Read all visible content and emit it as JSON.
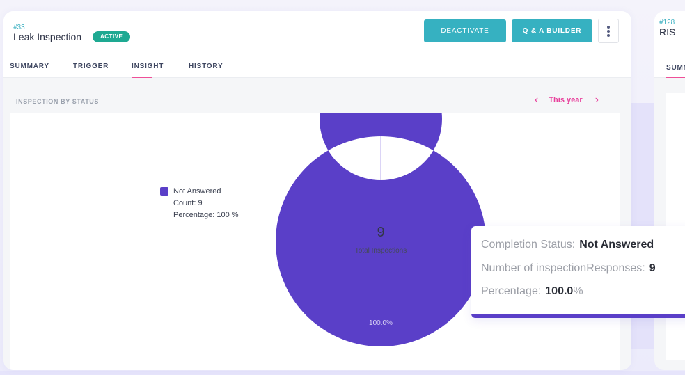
{
  "card": {
    "id": "#33",
    "title": "Leak Inspection",
    "status": "ACTIVE",
    "buttons": {
      "deactivate": "DEACTIVATE",
      "qa_builder": "Q & A BUILDER",
      "more": "more-options"
    },
    "tabs": [
      {
        "label": "SUMMARY",
        "active": false
      },
      {
        "label": "TRIGGER",
        "active": false
      },
      {
        "label": "INSIGHT",
        "active": true
      },
      {
        "label": "HISTORY",
        "active": false
      }
    ],
    "section_title": "INSPECTION BY STATUS",
    "period": {
      "label": "This year",
      "prev": "‹",
      "next": "›"
    }
  },
  "chart": {
    "legend": {
      "label": "Not Answered",
      "count": "Count: 9",
      "percentage": "Percentage: 100 %"
    },
    "center_value": "9",
    "center_label": "Total Inspections",
    "slice_label": "100.0%"
  },
  "chart_data": {
    "type": "pie",
    "variant": "donut",
    "title": "INSPECTION BY STATUS",
    "categories": [
      "Not Answered"
    ],
    "values": [
      9
    ],
    "percentages": [
      100.0
    ],
    "colors": [
      "#5a3fc8"
    ],
    "total": 9,
    "center_text": "Total Inspections",
    "legend_position": "left"
  },
  "tooltip": {
    "status_label": "Completion Status:",
    "status_value": "Not Answered",
    "count_label": "Number of inspectionResponses:",
    "count_value": "9",
    "pct_label": "Percentage:",
    "pct_value": "100.0",
    "pct_unit": "%"
  },
  "card2": {
    "id": "#128",
    "title": "RIS",
    "tab": "SUMM"
  },
  "colors": {
    "accent": "#36b1c1",
    "active_badge": "#1ea992",
    "tab_indicator": "#ef4f98",
    "donut": "#5a3fc8",
    "period": "#e8409c"
  }
}
